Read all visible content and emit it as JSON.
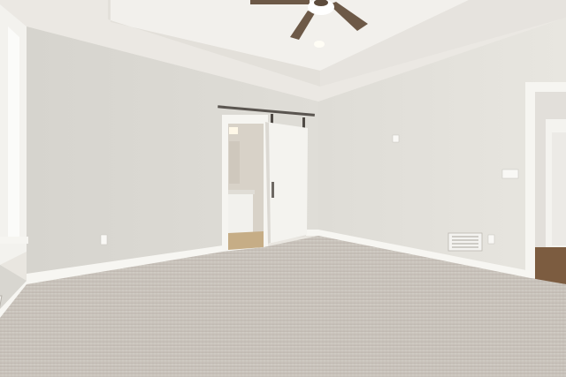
{
  "scene": {
    "description_hidden": "",
    "palette": {
      "wall_left": "#dcdbd6",
      "wall_back": "#e4e2dc",
      "wall_right": "#e6e4de",
      "ceiling": "#ece9e4",
      "tray": "#f1eeea",
      "carpet": "#c9c3bc",
      "trim": "#f6f5f1",
      "door": "#f3f2ee",
      "rail": "#5a5550",
      "floor_wood": "#7a5a3e",
      "fan_blade": "#6e5a48",
      "fan_light": "#ffffff"
    }
  }
}
